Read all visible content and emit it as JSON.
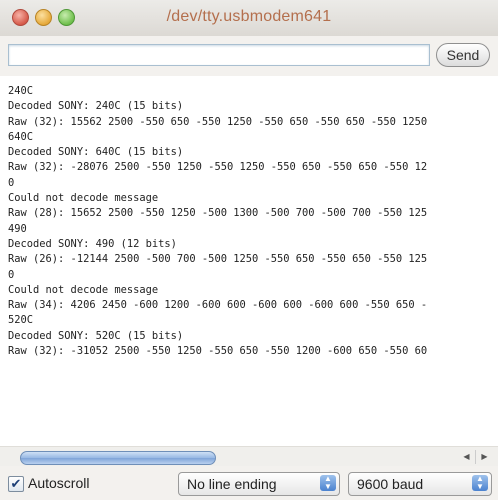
{
  "window": {
    "title": "/dev/tty.usbmodem641"
  },
  "input": {
    "value": "",
    "placeholder": ""
  },
  "send": {
    "label": "Send"
  },
  "output": {
    "lines": [
      "240C",
      "Decoded SONY: 240C (15 bits)",
      "Raw (32): 15562 2500 -550 650 -550 1250 -550 650 -550 650 -550 1250",
      "640C",
      "Decoded SONY: 640C (15 bits)",
      "Raw (32): -28076 2500 -550 1250 -550 1250 -550 650 -550 650 -550 12",
      "0",
      "Could not decode message",
      "Raw (28): 15652 2500 -550 1250 -500 1300 -500 700 -500 700 -550 125",
      "490",
      "Decoded SONY: 490 (12 bits)",
      "Raw (26): -12144 2500 -500 700 -500 1250 -550 650 -550 650 -550 125",
      "0",
      "Could not decode message",
      "Raw (34): 4206 2450 -600 1200 -600 600 -600 600 -600 600 -550 650 -",
      "520C",
      "Decoded SONY: 520C (15 bits)",
      "Raw (32): -31052 2500 -550 1250 -550 650 -550 1200 -600 650 -550 60"
    ]
  },
  "footer": {
    "autoscroll_label": "Autoscroll",
    "autoscroll_checked": true,
    "line_ending": "No line ending",
    "baud": "9600 baud"
  },
  "icons": {
    "close": "close-button-icon",
    "minimize": "minimize-button-icon",
    "zoom": "zoom-button-icon",
    "scroll_left": "scroll-left-arrow-icon",
    "scroll_right": "scroll-right-arrow-icon",
    "checkmark": "checkmark-icon",
    "select_arrows": "up-down-arrows-icon"
  },
  "colors": {
    "title_text": "#b46f4d",
    "scroll_thumb": "#97b8e3",
    "select_accent": "#4b82cf"
  }
}
